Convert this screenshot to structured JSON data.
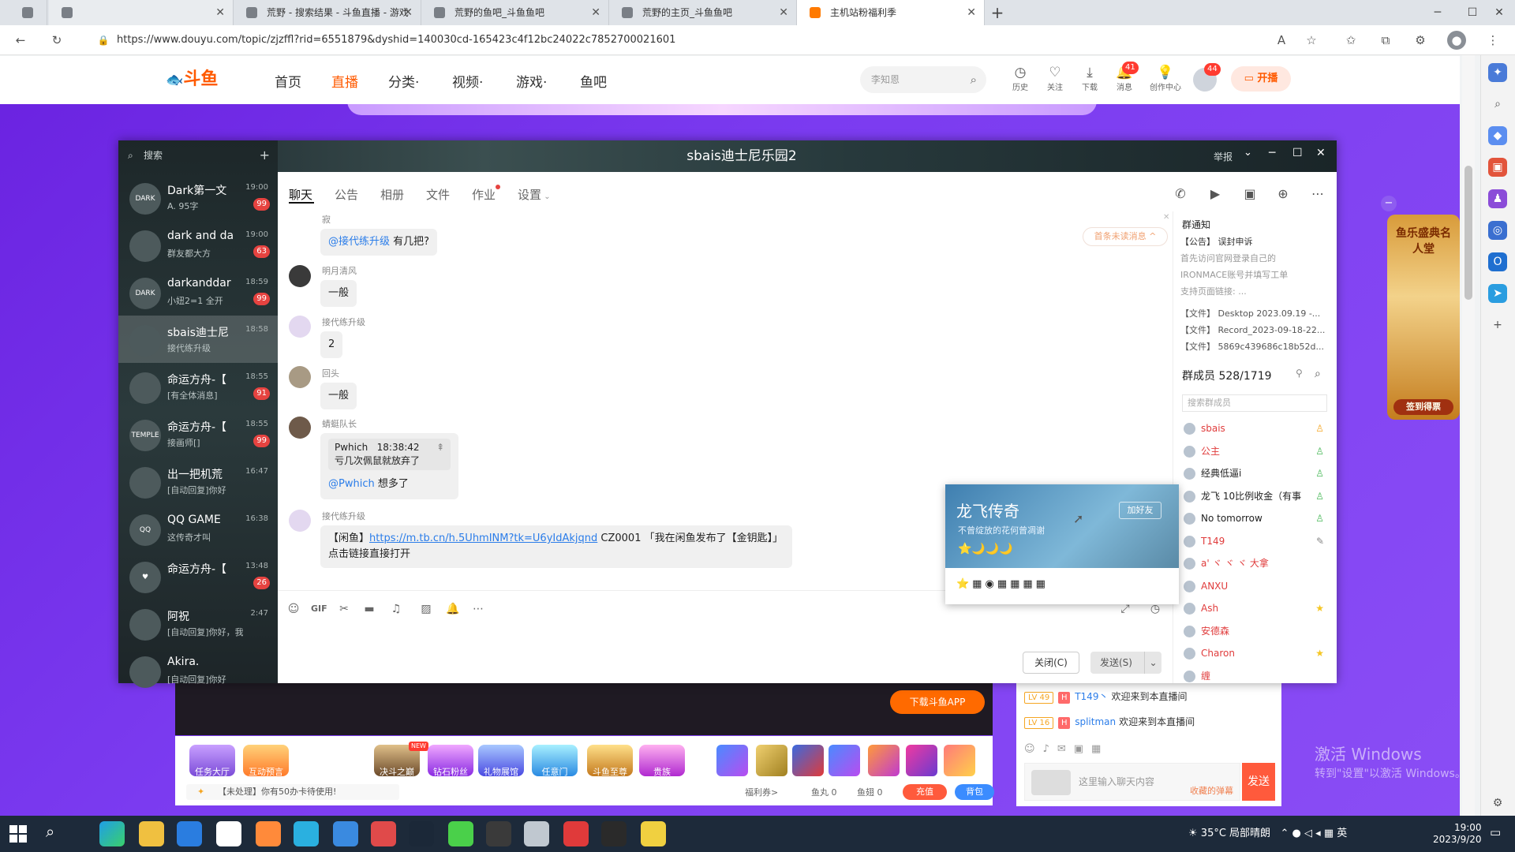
{
  "browser": {
    "tabs": [
      {
        "label": "",
        "active": false
      },
      {
        "label": "荒野 - 搜索结果 - 斗鱼直播 - 游戏",
        "active": false
      },
      {
        "label": "荒野的鱼吧_斗鱼鱼吧",
        "active": false
      },
      {
        "label": "荒野的主页_斗鱼鱼吧",
        "active": false
      },
      {
        "label": "主机站粉福利季",
        "active": true
      }
    ],
    "url": "https://www.douyu.com/topic/zjzffl?rid=6551879&dyshid=140030cd-165423c4f12bc24022c7852700021601"
  },
  "douyu": {
    "logo": "斗鱼",
    "nav": [
      "首页",
      "直播",
      "分类·",
      "视频·",
      "游戏·",
      "鱼吧"
    ],
    "active_nav": "直播",
    "search_placeholder": "李知恩",
    "tools": [
      {
        "icon": "history-icon",
        "label": "历史"
      },
      {
        "icon": "heart-icon",
        "label": "关注"
      },
      {
        "icon": "download-icon",
        "label": "下载"
      },
      {
        "icon": "bell-icon",
        "label": "消息",
        "badge": "41"
      },
      {
        "icon": "bulb-icon",
        "label": "创作中心"
      }
    ],
    "avatar_badge": "44",
    "kaibo": "开播",
    "download_app": "下载斗鱼APP",
    "gifts": [
      "任务大厅",
      "互动预言",
      "决斗之巅",
      "钻石粉丝",
      "礼物展馆",
      "任意门",
      "斗鱼至尊",
      "贵族"
    ],
    "gift_badge": "NEW",
    "tip": "【未处理】你有50办卡待使用!",
    "stats": [
      "福利券>",
      "鱼丸 0",
      "鱼翅 0"
    ],
    "recharge": "充值",
    "bag": "背包",
    "chat": [
      {
        "lv": "LV 49",
        "user": "T149丶",
        "text": "欢迎来到本直播间"
      },
      {
        "lv": "LV 16",
        "user": "splitman",
        "text": "欢迎来到本直播间"
      }
    ],
    "chat_placeholder": "这里输入聊天内容",
    "chat_hint": "收藏的弹幕",
    "send": "发送",
    "ad_text": "鱼乐盛典名人堂",
    "ad_btn": "签到得票"
  },
  "qq": {
    "title": "sbais迪士尼乐园2",
    "report": "举报",
    "search": "搜索",
    "conversations": [
      {
        "name": "Dark第一文",
        "msg": "A. 95字",
        "time": "19:00",
        "badge": "99",
        "av": "DARK"
      },
      {
        "name": "dark and da",
        "msg": "群友都大方",
        "time": "19:00",
        "badge": "63",
        "av": ""
      },
      {
        "name": "darkanddar",
        "msg": "小妞2=1 全开",
        "time": "18:59",
        "badge": "99",
        "av": "DARK"
      },
      {
        "name": "sbais迪士尼",
        "msg": "接代练升级",
        "time": "18:58",
        "badge": "",
        "av": "",
        "active": true
      },
      {
        "name": "命运方舟-【",
        "msg": "[有全体消息]",
        "time": "18:55",
        "badge": "91",
        "av": ""
      },
      {
        "name": "命运方舟-【",
        "msg": "接画师[]",
        "time": "18:55",
        "badge": "99",
        "av": "TEMPLE"
      },
      {
        "name": "出一把机荒",
        "msg": "[自动回复]你好",
        "time": "16:47",
        "badge": "",
        "av": ""
      },
      {
        "name": "QQ GAME",
        "msg": "这传奇才叫",
        "time": "16:38",
        "badge": "",
        "av": "QQ"
      },
      {
        "name": "命运方舟-【",
        "msg": "",
        "time": "13:48",
        "badge": "26",
        "av": "♥"
      },
      {
        "name": "阿祝",
        "msg": "[自动回复]你好，我现",
        "time": "2:47",
        "badge": "",
        "av": ""
      },
      {
        "name": "Akira.",
        "msg": "[自动回复]你好",
        "time": "",
        "badge": "",
        "av": ""
      }
    ],
    "tabs": [
      "聊天",
      "公告",
      "相册",
      "文件",
      "作业",
      "设置"
    ],
    "unread": "首条未读消息 ^",
    "messages": [
      {
        "name": "寂",
        "mention": "@接代练升级",
        "text": "有几把?"
      },
      {
        "name": "明月清风",
        "text": "一般"
      },
      {
        "name": "接代练升级",
        "text": "2"
      },
      {
        "name": "回头",
        "text": "一般"
      },
      {
        "name": "蜻蜓队长",
        "quote_user": "Pwhich",
        "quote_time": "18:38:42",
        "quote_text": "亏几次佩鼠就放弃了",
        "mention": "@Pwhich",
        "text": "想多了"
      },
      {
        "name": "接代练升级",
        "prefix": "【闲鱼】",
        "link": "https://m.tb.cn/h.5UhmINM?tk=U6yIdAkjqnd",
        "suffix": "CZ0001 「我在闲鱼发布了【金钥匙】」",
        "line2": "点击链接直接打开"
      }
    ],
    "close": "关闭(C)",
    "send": "发送(S)",
    "notice_title": "群通知",
    "notice": [
      "【公告】 误封申诉",
      "首先访问官网登录自己的",
      "IRONMACE账号并填写工单",
      "支持页面链接: ..."
    ],
    "files": [
      "【文件】 Desktop 2023.09.19 -...",
      "【文件】 Record_2023-09-18-22...",
      "【文件】 5869c439686c18b52d..."
    ],
    "members_title": "群成员 528/1719",
    "member_search": "搜索群成员",
    "members": [
      {
        "name": "sbais",
        "red": true,
        "role": "owner"
      },
      {
        "name": "公主",
        "red": true,
        "role": "admin"
      },
      {
        "name": "经典低逼i",
        "red": false,
        "role": "admin"
      },
      {
        "name": "龙飞 10比例收金（有事",
        "red": false,
        "role": "admin"
      },
      {
        "name": "No tomorrow",
        "red": false,
        "role": "admin"
      },
      {
        "name": "T149",
        "red": true,
        "role": "edit"
      },
      {
        "name": "a' ヾ ヾ ヾ   大拿",
        "red": true,
        "role": ""
      },
      {
        "name": "ANXU",
        "red": true,
        "role": ""
      },
      {
        "name": "Ash",
        "red": true,
        "role": "star"
      },
      {
        "name": "安德森",
        "red": true,
        "role": ""
      },
      {
        "name": "Charon",
        "red": true,
        "role": "star"
      },
      {
        "name": "缠",
        "red": true,
        "role": ""
      }
    ],
    "card": {
      "name": "龙飞传奇",
      "sig": "不曾绽放的花何曾凋谢",
      "add": "加好友",
      "badges": "⭐🌙🌙🌙",
      "icons": "⭐▦◉▦▦▦▦"
    }
  },
  "windows": {
    "activate1": "激活 Windows",
    "activate2": "转到\"设置\"以激活 Windows。",
    "weather": "35°C 局部晴朗",
    "ime": "英",
    "time": "19:00",
    "date": "2023/9/20"
  }
}
